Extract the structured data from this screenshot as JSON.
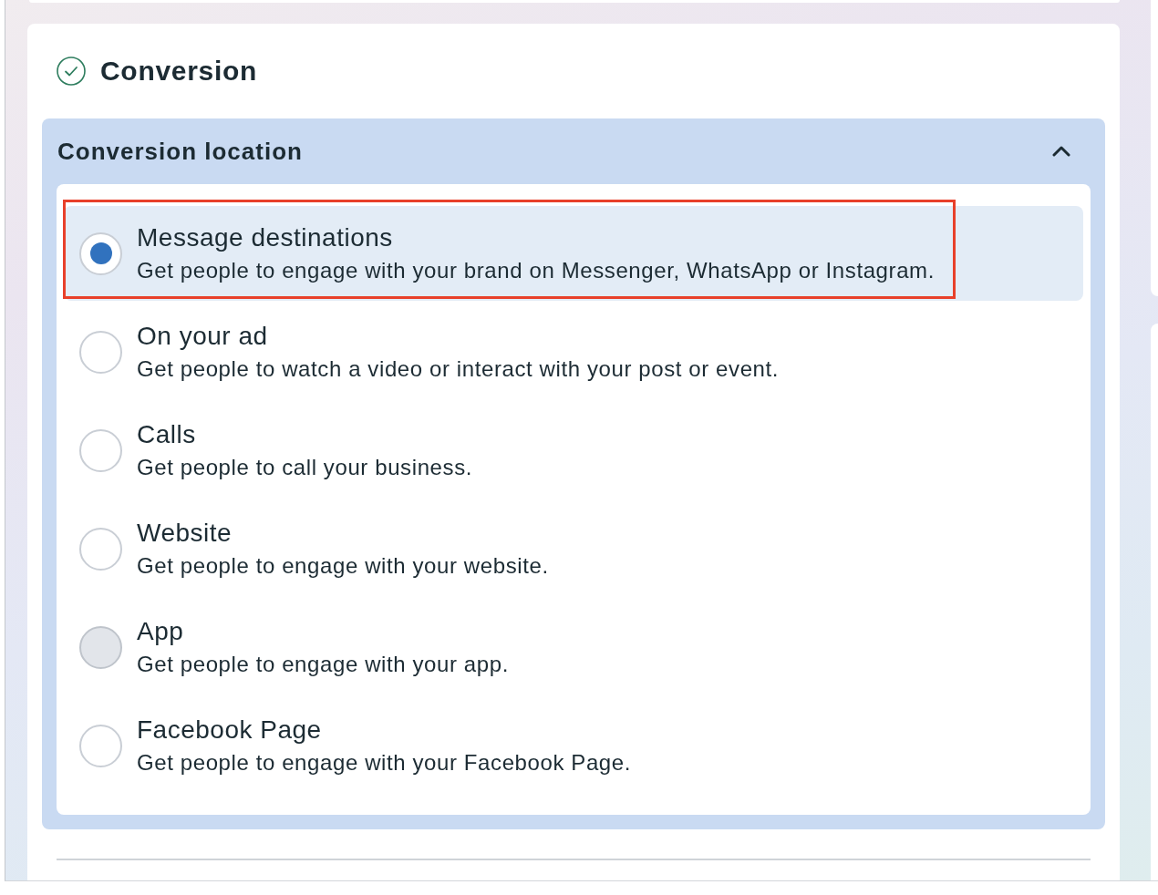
{
  "section": {
    "title": "Conversion",
    "completed": true
  },
  "accordion": {
    "title": "Conversion location",
    "expanded": true,
    "options": [
      {
        "label": "Message destinations",
        "description": "Get people to engage with your brand on Messenger, WhatsApp or Instagram.",
        "selected": true,
        "hovered": false,
        "annotated": true
      },
      {
        "label": "On your ad",
        "description": "Get people to watch a video or interact with your post or event.",
        "selected": false,
        "hovered": false,
        "annotated": false
      },
      {
        "label": "Calls",
        "description": "Get people to call your business.",
        "selected": false,
        "hovered": false,
        "annotated": false
      },
      {
        "label": "Website",
        "description": "Get people to engage with your website.",
        "selected": false,
        "hovered": false,
        "annotated": false
      },
      {
        "label": "App",
        "description": "Get people to engage with your app.",
        "selected": false,
        "hovered": true,
        "annotated": false
      },
      {
        "label": "Facebook Page",
        "description": "Get people to engage with your Facebook Page.",
        "selected": false,
        "hovered": false,
        "annotated": false
      }
    ]
  }
}
